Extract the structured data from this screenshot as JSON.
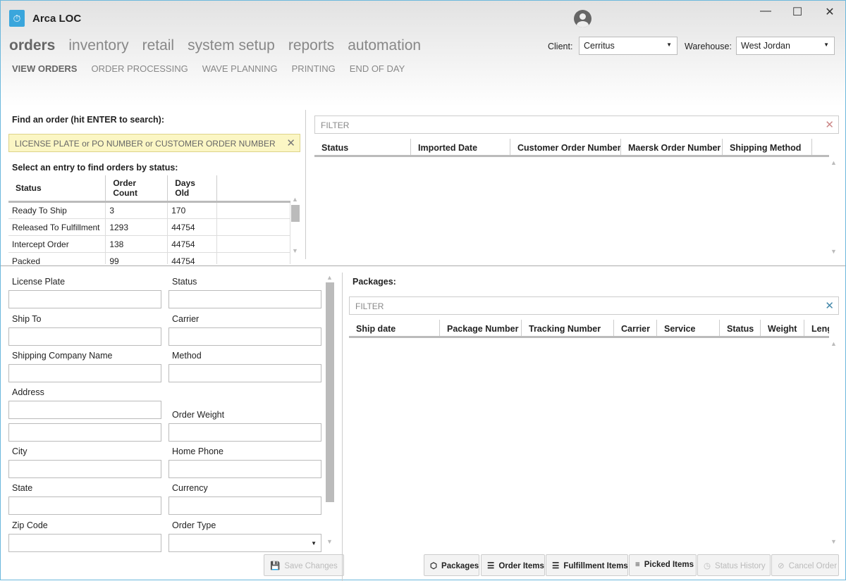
{
  "app": {
    "title": "Arca LOC",
    "icon": "stopwatch-icon"
  },
  "window_controls": {
    "minimize": "—",
    "maximize": "☐",
    "close": "✕"
  },
  "nav": {
    "items": [
      "orders",
      "inventory",
      "retail",
      "system setup",
      "reports",
      "automation"
    ],
    "active": "orders"
  },
  "subnav": {
    "items": [
      "VIEW ORDERS",
      "ORDER PROCESSING",
      "WAVE PLANNING",
      "PRINTING",
      "END OF DAY"
    ],
    "active": "VIEW ORDERS"
  },
  "client": {
    "label": "Client:",
    "value": "Cerritus"
  },
  "warehouse": {
    "label": "Warehouse:",
    "value": "West Jordan"
  },
  "find": {
    "label": "Find an order (hit ENTER to search):",
    "placeholder": "LICENSE PLATE or PO NUMBER or CUSTOMER ORDER NUMBER"
  },
  "status_table": {
    "label": "Select an entry to find orders by status:",
    "columns": [
      "Status",
      "Order Count",
      "Days Old"
    ],
    "rows": [
      [
        "Ready To Ship",
        "3",
        "170"
      ],
      [
        "Released To Fulfillment",
        "1293",
        "44754"
      ],
      [
        "Intercept Order",
        "138",
        "44754"
      ],
      [
        "Packed",
        "99",
        "44754"
      ]
    ]
  },
  "orders_grid": {
    "filter": "FILTER",
    "columns": [
      "Status",
      "Imported Date",
      "Customer Order Number",
      "Maersk Order Number",
      "Shipping Method"
    ]
  },
  "form": {
    "fields_left": [
      "License Plate",
      "Ship To",
      "Shipping Company Name",
      "Address",
      "City",
      "State",
      "Zip Code"
    ],
    "fields_right": [
      "Status",
      "Carrier",
      "Method",
      "Order Weight",
      "Home Phone",
      "Currency",
      "Order Type"
    ],
    "save": "Save Changes"
  },
  "packages": {
    "label": "Packages:",
    "filter": "FILTER",
    "columns": [
      "Ship date",
      "Package Number",
      "Tracking Number",
      "Carrier",
      "Service",
      "Status",
      "Weight",
      "Leng"
    ]
  },
  "buttons": [
    {
      "label": "Packages",
      "icon": "cube-icon",
      "enabled": true
    },
    {
      "label": "Order Items",
      "icon": "list-icon",
      "enabled": true
    },
    {
      "label": "Fulfillment Items",
      "icon": "checklist-icon",
      "enabled": true
    },
    {
      "label": "Picked Items",
      "icon": "picked-list-icon",
      "enabled": true
    },
    {
      "label": "Status History",
      "icon": "history-icon",
      "enabled": false
    },
    {
      "label": "Cancel Order",
      "icon": "cancel-icon",
      "enabled": false
    }
  ]
}
